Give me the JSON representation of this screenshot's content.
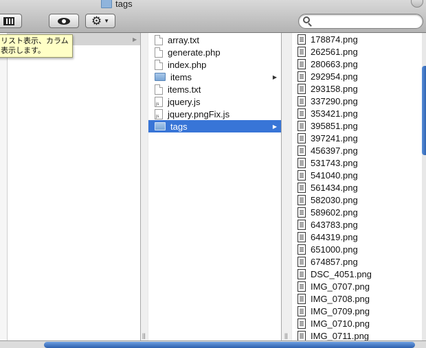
{
  "window": {
    "title": "tags"
  },
  "search": {
    "placeholder": ""
  },
  "tooltip": {
    "line1": "リスト表示、カラム",
    "line2": "表示します。"
  },
  "column2": [
    {
      "label": "array.txt",
      "icon": "text-file-icon",
      "kind": "doc"
    },
    {
      "label": "generate.php",
      "icon": "text-file-icon",
      "kind": "doc"
    },
    {
      "label": "index.php",
      "icon": "text-file-icon",
      "kind": "doc"
    },
    {
      "label": "items",
      "icon": "folder-icon",
      "kind": "folder"
    },
    {
      "label": "items.txt",
      "icon": "text-file-icon",
      "kind": "doc"
    },
    {
      "label": "jquery.js",
      "icon": "js-file-icon",
      "kind": "js"
    },
    {
      "label": "jquery.pngFix.js",
      "icon": "js-file-icon",
      "kind": "js"
    },
    {
      "label": "tags",
      "icon": "folder-icon",
      "kind": "folder",
      "selected": true
    }
  ],
  "column3": [
    "178874.png",
    "262561.png",
    "280663.png",
    "292954.png",
    "293158.png",
    "337290.png",
    "353421.png",
    "395851.png",
    "397241.png",
    "456397.png",
    "531743.png",
    "541040.png",
    "561434.png",
    "582030.png",
    "589602.png",
    "643783.png",
    "644319.png",
    "651000.png",
    "674857.png",
    "DSC_4051.png",
    "IMG_0707.png",
    "IMG_0708.png",
    "IMG_0709.png",
    "IMG_0710.png",
    "IMG_0711.png"
  ],
  "colors": {
    "selection": "#3875d7",
    "tooltip_bg": "#ffffc6"
  },
  "icons": {
    "column_view": "column-view-icon",
    "quick_look": "eye-icon",
    "action": "gear-icon",
    "search": "search-icon"
  }
}
